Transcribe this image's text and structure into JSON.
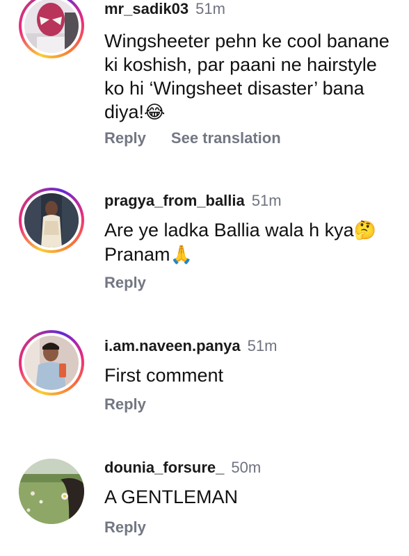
{
  "comments": [
    {
      "username": "mr_sadik03",
      "time": "51m",
      "text": "Wingsheeter pehn ke cool banane ki koshish, par paani ne hairstyle ko hi ‘Wingsheet disaster’ bana diya!",
      "emoji": "😂",
      "reply": "Reply",
      "translation": "See translation"
    },
    {
      "username": "pragya_from_ballia",
      "time": "51m",
      "text": "Are ye ladka Ballia wala h kya",
      "emoji": "🤔",
      "text2": "Pranam",
      "emoji2": "🙏",
      "reply": "Reply"
    },
    {
      "username": "i.am.naveen.panya",
      "time": "51m",
      "text": "First comment",
      "reply": "Reply"
    },
    {
      "username": "dounia_forsure_",
      "time": "50m",
      "text": "A GENTLEMAN",
      "reply": "Reply"
    }
  ]
}
